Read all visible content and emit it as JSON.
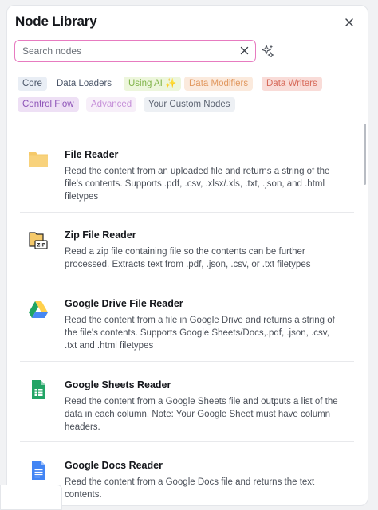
{
  "panel": {
    "title": "Node Library"
  },
  "search": {
    "placeholder": "Search nodes",
    "value": ""
  },
  "filters": {
    "core": "Core",
    "data_loaders": "Data Loaders",
    "using_ai": "Using AI ✨",
    "data_modifiers": "Data Modifiers",
    "data_writers": "Data Writers",
    "control_flow": "Control Flow",
    "advanced": "Advanced",
    "custom_nodes": "Your Custom Nodes"
  },
  "nodes": [
    {
      "name": "File Reader",
      "description": "Read the content from an uploaded file and returns a string of the file's contents. Supports .pdf, .csv, .xlsx/.xls, .txt, .json, and .html filetypes",
      "icon": "folder-icon"
    },
    {
      "name": "Zip File Reader",
      "description": "Read a zip file containing file so the contents can be further processed. Extracts text from .pdf, .json, .csv, or .txt filetypes",
      "icon": "zip-file-icon"
    },
    {
      "name": "Google Drive File Reader",
      "description": "Read the content from a file in Google Drive and returns a string of the file's contents. Supports Google Sheets/Docs,.pdf, .json, .csv, .txt and .html filetypes",
      "icon": "google-drive-icon"
    },
    {
      "name": "Google Sheets Reader",
      "description": "Read the content from a Google Sheets file and outputs a list of the data in each column. Note: Your Google Sheet must have column headers.",
      "icon": "google-sheets-icon"
    },
    {
      "name": "Google Docs Reader",
      "description": "Read the content from a Google Docs file and returns the text contents.",
      "icon": "google-docs-icon"
    }
  ],
  "colors": {
    "search_border": "#e77bc0",
    "folder": "#f5c96a",
    "drive_green": "#1fa463",
    "drive_yellow": "#ffd04b",
    "drive_blue": "#4688f4",
    "sheets_green": "#23a566",
    "docs_blue": "#4285f4"
  }
}
